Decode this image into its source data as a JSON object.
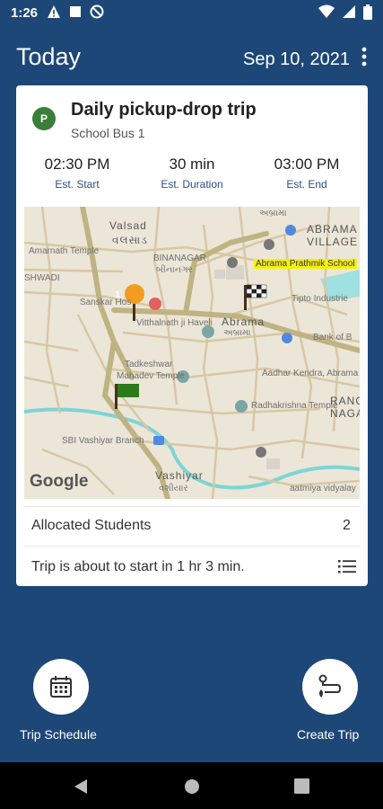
{
  "status_bar": {
    "time": "1:26",
    "left_icons": [
      "warning-icon",
      "square-icon",
      "do-not-disturb-icon"
    ],
    "right_icons": [
      "wifi-icon",
      "signal-icon",
      "battery-icon"
    ]
  },
  "header": {
    "title": "Today",
    "date": "Sep 10, 2021",
    "menu_icon": "more-vert-icon"
  },
  "trip": {
    "badge": "P",
    "title": "Daily pickup-drop trip",
    "bus": "School Bus 1",
    "start_time": "02:30 PM",
    "start_label": "Est. Start",
    "duration": "30 min",
    "duration_label": "Est. Duration",
    "end_time": "03:00 PM",
    "end_label": "Est. End"
  },
  "map": {
    "labels": {
      "valsad": "Valsad",
      "valsad_guj": "વલસાડ",
      "abrama_village": "ABRAMA",
      "abrama_village2": "VILLAGE",
      "abrama_village_guj": "અબ્રામા",
      "binanagar": "BINANAGAR",
      "binanagar_guj": "બીનાનગર",
      "amarnath": "Amarnath Temple",
      "shwadi": "SHWADI",
      "school": "Abrama Prathmik School",
      "sanskar": "Sanskar Hos",
      "tipto": "Tipto Industrie",
      "vitthalnath": "Vitthalnath ji Haveli",
      "abrama": "Abrama",
      "abrama_guj": "અબ્રામા",
      "bank": "Bank of B",
      "tadkeshwar": "Tadkeshwar",
      "mahadev": "Mahadev Temple",
      "aadhar": "Aadhar Kendra, Abrama",
      "radhakrishna": "Radhakrishna Temple",
      "ranch": "RANCH",
      "nagar": "NAGAR",
      "sbi": "SBI Vashiyar Branch",
      "vashiyar": "Vashiyar",
      "vashiyar_guj": "વશીયાર",
      "vidyalay": "aatmiya vidyalay",
      "google": "Google",
      "pin_number": "1"
    },
    "colors": {
      "road": "#d5c9a4",
      "major_road": "#c0b383",
      "water": "#7dd4d6",
      "background": "#f2efe9",
      "start_flag": "#2c7a1c",
      "pin": "#f39c1f"
    }
  },
  "allocated": {
    "label": "Allocated Students",
    "count": "2"
  },
  "status": {
    "text": "Trip is about to start in 1 hr 3 min.",
    "icon": "list-icon"
  },
  "actions": {
    "schedule_label": "Trip Schedule",
    "schedule_icon": "calendar-icon",
    "create_label": "Create Trip",
    "create_icon": "route-icon"
  },
  "nav": {
    "back_icon": "back-icon",
    "home_icon": "home-icon",
    "recents_icon": "recents-icon"
  }
}
